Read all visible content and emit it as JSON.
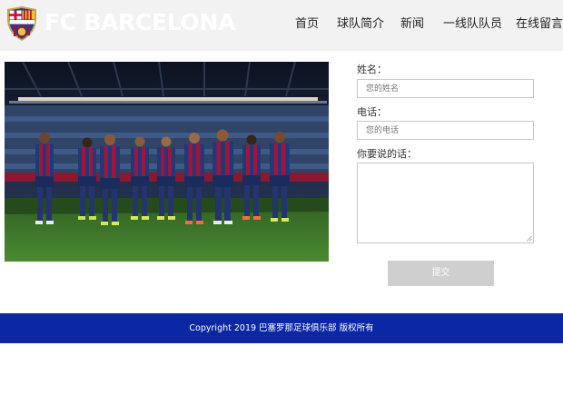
{
  "header": {
    "brand": "FC BARCELONA",
    "nav": [
      {
        "label": "首页"
      },
      {
        "label": "球队简介"
      },
      {
        "label": "新闻"
      },
      {
        "label": "一线队队员"
      },
      {
        "label": "在线留言"
      }
    ]
  },
  "colors": {
    "header_bg": "#f2f2f2",
    "footer_bg": "#0c27a4",
    "submit_bg": "#cfcfcf",
    "kit_blue": "#1f3a7a",
    "kit_red": "#a5133b",
    "pitch_green": "#3e7a2a"
  },
  "form": {
    "name_label": "姓名：",
    "name_placeholder": "您的姓名",
    "phone_label": "电话：",
    "phone_placeholder": "您的电话",
    "message_label": "你要说的话：",
    "message_value": "",
    "submit_label": "提交"
  },
  "footer": {
    "copyright": "Copyright 2019 巴塞罗那足球俱乐部 版权所有"
  }
}
